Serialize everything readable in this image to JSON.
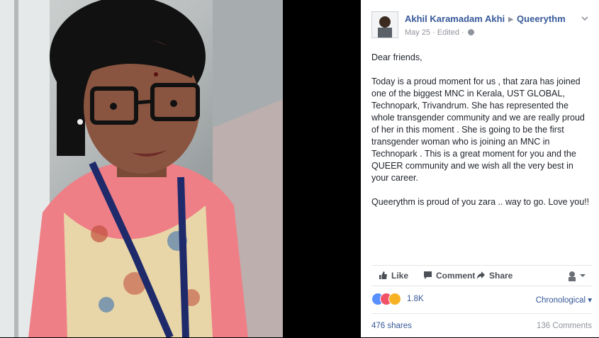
{
  "post": {
    "author": "Akhil Karamadam Akhi",
    "target_page": "Queerythm",
    "date": "May 25",
    "edited": "Edited",
    "paragraphs": [
      "Dear friends,",
      "Today is a proud moment for us , that zara has joined one of the biggest MNC in Kerala, UST GLOBAL, Technopark, Trivandrum. She has represented the whole transgender community and we are really proud of her in this moment . She is going to be the first transgender woman who is joining an MNC in Technopark . This is a great moment for you and the QUEER community and we wish all the very best in your career.",
      "Queerythm is proud of you zara .. way to go. Love you!!"
    ]
  },
  "actions": {
    "like": "Like",
    "comment": "Comment",
    "share": "Share"
  },
  "reactions": {
    "count": "1.8K",
    "types": [
      "like-icon",
      "love-icon",
      "wow-icon"
    ]
  },
  "sort": {
    "selected": "Chronological"
  },
  "stats": {
    "shares": "476 shares",
    "comments": "136 Comments"
  },
  "colors": {
    "link": "#365899",
    "muted": "#90949c",
    "like_blue": "#5890ff",
    "love_red": "#f25268",
    "wow_yellow": "#f7b125"
  }
}
